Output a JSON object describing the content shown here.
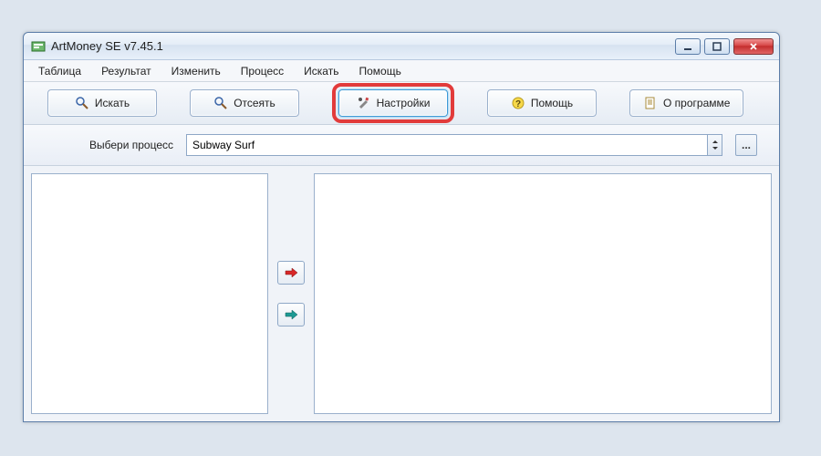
{
  "window": {
    "title": "ArtMoney SE v7.45.1"
  },
  "menu": {
    "items": [
      "Таблица",
      "Результат",
      "Изменить",
      "Процесс",
      "Искать",
      "Помощь"
    ]
  },
  "toolbar": {
    "search": "Искать",
    "filter": "Отсеять",
    "settings": "Настройки",
    "help": "Помощь",
    "about": "О программе"
  },
  "process": {
    "label": "Выбери процесс",
    "value": "Subway Surf",
    "ellipsis": "..."
  }
}
